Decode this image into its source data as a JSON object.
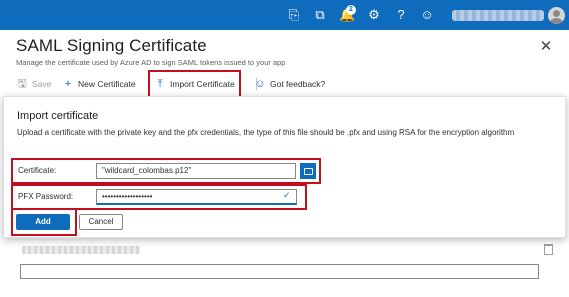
{
  "topbar": {
    "icons": [
      "terminal-icon",
      "filter-directory-icon",
      "notifications-bell-icon",
      "settings-gear-icon",
      "help-question-icon",
      "feedback-person-icon",
      "user-avatar"
    ],
    "notifications_count": "2",
    "accent_color": "#0f6cbd"
  },
  "blade": {
    "title": "SAML Signing Certificate",
    "subtitle": "Manage the certificate used by Azure AD to sign SAML tokens issued to your app",
    "close_icon": "close-icon"
  },
  "toolbar": {
    "save_label": "Save",
    "new_cert_label": "New Certificate",
    "import_cert_label": "Import Certificate",
    "feedback_label": "Got feedback?"
  },
  "import_panel": {
    "title": "Import certificate",
    "description": "Upload a certificate with the private key and the pfx credentials, the type of this file should be .pfx and using RSA for the encryption algorithm",
    "certificate_label": "Certificate:",
    "certificate_value": "\"wildcard_colombas.p12\"",
    "pfx_label": "PFX Password:",
    "pfx_value": "••••••••••••••••••",
    "add_label": "Add",
    "cancel_label": "Cancel"
  },
  "highlight_color": "#c50f1f"
}
